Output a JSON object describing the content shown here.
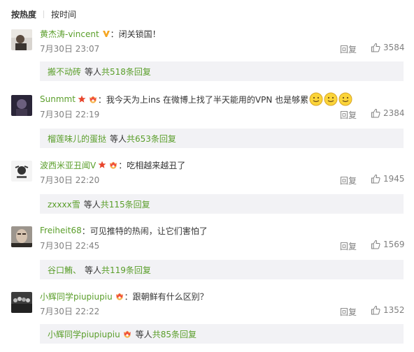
{
  "sort_tabs": {
    "active": "按热度",
    "other": "按时间"
  },
  "colors": {
    "link_orange": "#eb7350",
    "link_green": "#5a9e2a",
    "meta_grey": "#808080",
    "sub_bg": "#f2f2f5"
  },
  "comments": [
    {
      "username": "黄杰涛-vincent",
      "text": "：闭关锁国！",
      "time": "7月30日 23:07",
      "reply_label": "回复",
      "likes": "3584",
      "sub_user": "搬不动砖",
      "sub_mid": "等人",
      "sub_count": "共518条回复"
    },
    {
      "username": "Sunmmt",
      "text": "：我今天为上ins 在微博上找了半天能用的VPN 也是够累",
      "time": "7月30日 22:19",
      "reply_label": "回复",
      "likes": "2384",
      "sub_user": "榴莲味儿的蛋挞",
      "sub_mid": "等人",
      "sub_count": "共653条回复"
    },
    {
      "username": "波西米亚丑闻V",
      "text": "：吃相越来越丑了",
      "time": "7月30日 22:20",
      "reply_label": "回复",
      "likes": "1945",
      "sub_user": "zxxxx雪",
      "sub_mid": "等人",
      "sub_count": "共115条回复"
    },
    {
      "username": "Freiheit68",
      "text": "：可见推特的热闹，让它们害怕了",
      "time": "7月30日 22:45",
      "reply_label": "回复",
      "likes": "1569",
      "sub_user": "谷口鮪、",
      "sub_mid": "等人",
      "sub_count": "共119条回复"
    },
    {
      "username": "小辉同学piupiupiu",
      "text": "：跟朝鲜有什么区别？",
      "time": "7月30日 22:22",
      "reply_label": "回复",
      "likes": "1352",
      "sub_user": "小辉同学piupiupiu",
      "sub_mid": "等人",
      "sub_count": "共85条回复"
    }
  ]
}
